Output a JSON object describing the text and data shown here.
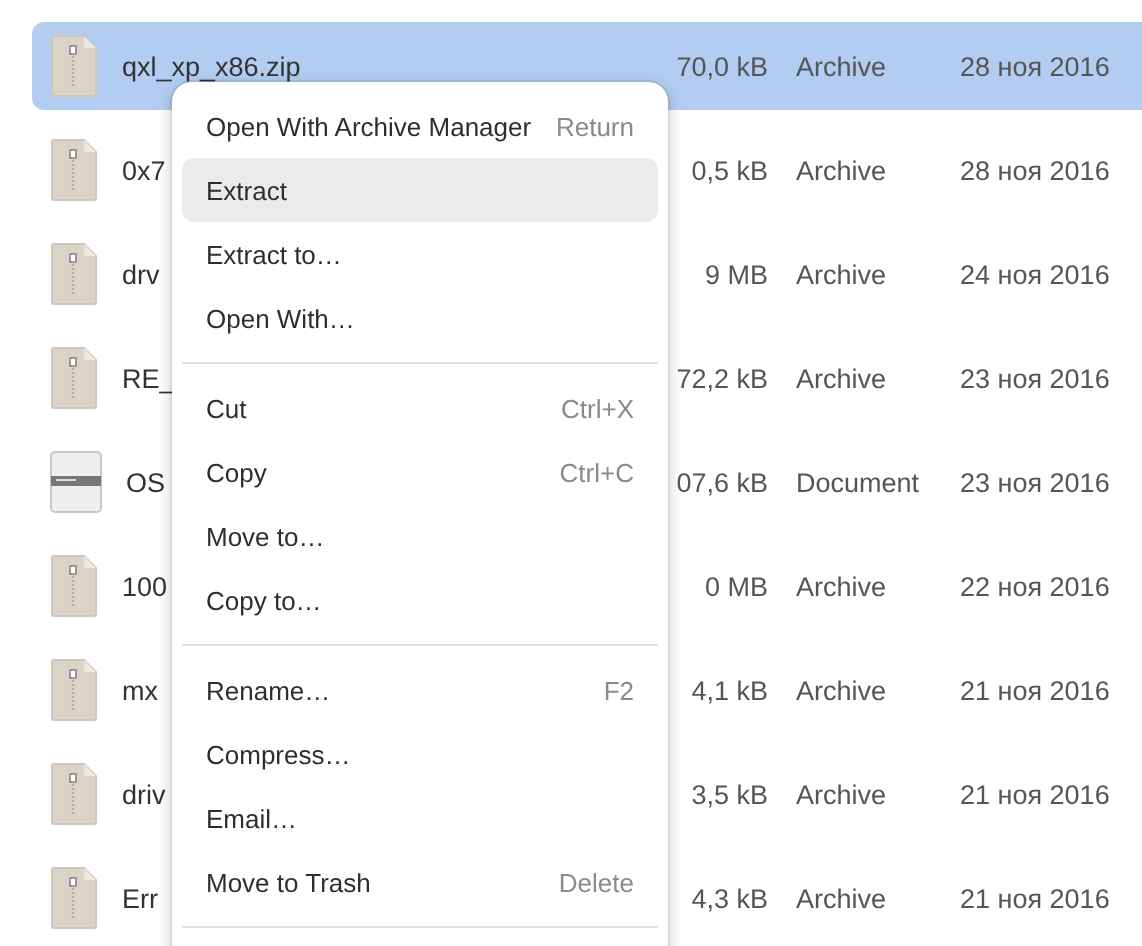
{
  "files": [
    {
      "name": "qxl_xp_x86.zip",
      "size": "70,0 kB",
      "type": "Archive",
      "modified": "28 ноя 2016",
      "kind": "archive",
      "selected": true
    },
    {
      "name": "0x7",
      "size": "0,5 kB",
      "type": "Archive",
      "modified": "28 ноя 2016",
      "kind": "archive",
      "selected": false
    },
    {
      "name": "drv",
      "size": "9 MB",
      "type": "Archive",
      "modified": "24 ноя 2016",
      "kind": "archive",
      "selected": false
    },
    {
      "name": "RE_",
      "size": "72,2 kB",
      "type": "Archive",
      "modified": "23 ноя 2016",
      "kind": "archive",
      "selected": false
    },
    {
      "name": "OS",
      "size": "07,6 kB",
      "type": "Document",
      "modified": "23 ноя 2016",
      "kind": "document",
      "selected": false
    },
    {
      "name": "100",
      "size": "0 MB",
      "type": "Archive",
      "modified": "22 ноя 2016",
      "kind": "archive",
      "selected": false
    },
    {
      "name": "mx",
      "size": "4,1 kB",
      "type": "Archive",
      "modified": "21 ноя 2016",
      "kind": "archive",
      "selected": false
    },
    {
      "name": "driv",
      "size": "3,5 kB",
      "type": "Archive",
      "modified": "21 ноя 2016",
      "kind": "archive",
      "selected": false
    },
    {
      "name": "Err",
      "size": "4,3 kB",
      "type": "Archive",
      "modified": "21 ноя 2016",
      "kind": "archive",
      "selected": false
    }
  ],
  "context_menu": [
    {
      "kind": "item",
      "label": "Open With Archive Manager",
      "shortcut": "Return",
      "selected": false
    },
    {
      "kind": "item",
      "label": "Extract",
      "selected": true
    },
    {
      "kind": "item",
      "label": "Extract to…",
      "selected": false
    },
    {
      "kind": "item",
      "label": "Open With…",
      "selected": false
    },
    {
      "kind": "separator"
    },
    {
      "kind": "item",
      "label": "Cut",
      "shortcut": "Ctrl+X",
      "selected": false
    },
    {
      "kind": "item",
      "label": "Copy",
      "shortcut": "Ctrl+C",
      "selected": false
    },
    {
      "kind": "item",
      "label": "Move to…",
      "selected": false
    },
    {
      "kind": "item",
      "label": "Copy to…",
      "selected": false
    },
    {
      "kind": "separator"
    },
    {
      "kind": "item",
      "label": "Rename…",
      "shortcut": "F2",
      "selected": false
    },
    {
      "kind": "item",
      "label": "Compress…",
      "selected": false
    },
    {
      "kind": "item",
      "label": "Email…",
      "selected": false
    },
    {
      "kind": "item",
      "label": "Move to Trash",
      "shortcut": "Delete",
      "selected": false
    },
    {
      "kind": "separator"
    }
  ]
}
